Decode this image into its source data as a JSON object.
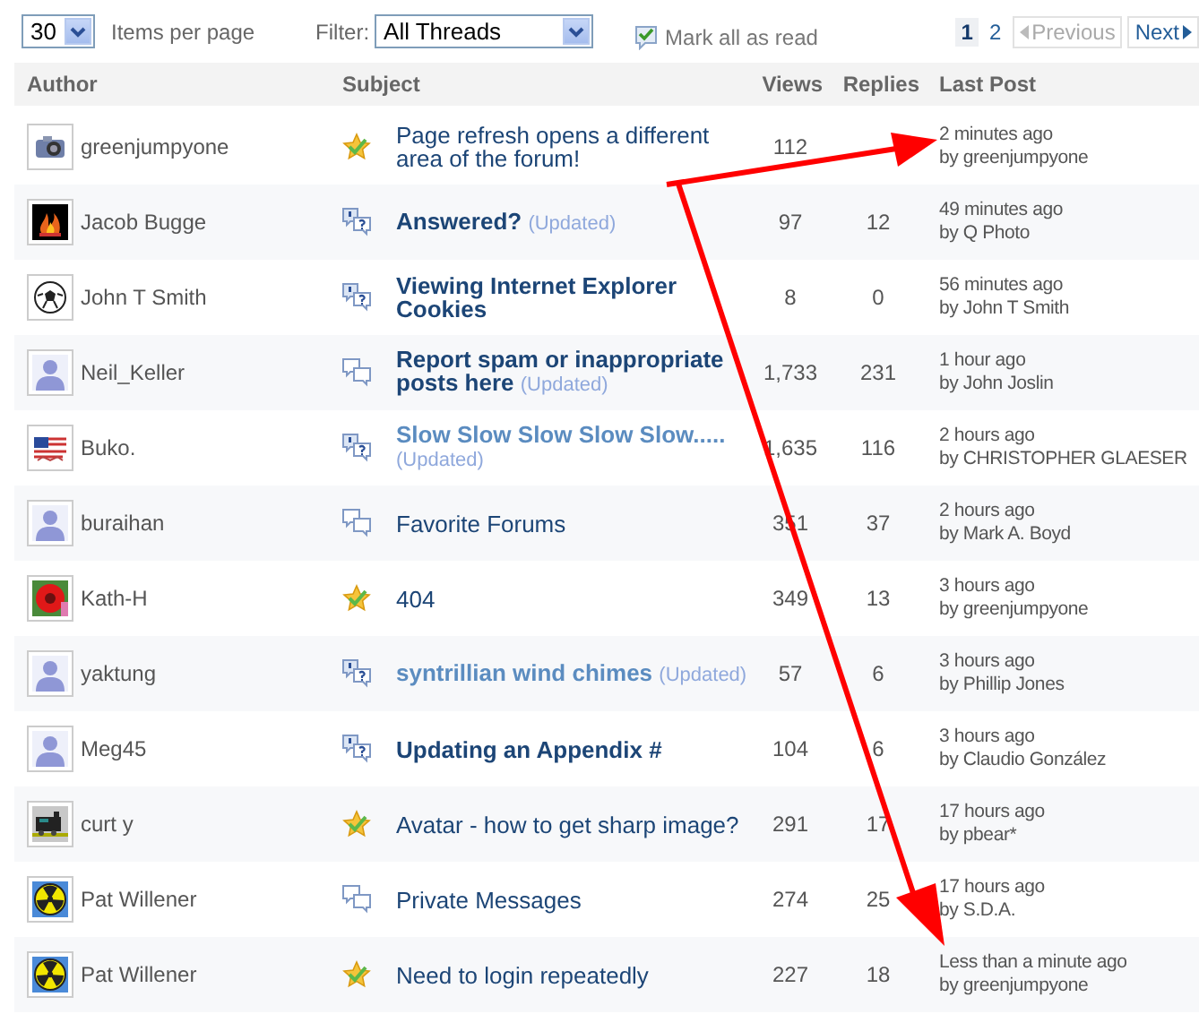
{
  "toolbar": {
    "page_size": "30",
    "page_size_label": "Items per page",
    "filter_label": "Filter:",
    "filter_value": "All Threads",
    "mark_read": "Mark all as read"
  },
  "pager": {
    "pages": [
      {
        "label": "1",
        "selected": true
      },
      {
        "label": "2",
        "selected": false
      }
    ],
    "previous": {
      "label": "Previous",
      "disabled": true
    },
    "next": {
      "label": "Next",
      "disabled": false
    }
  },
  "columns": [
    "Author",
    "Subject",
    "Views",
    "Replies",
    "Last Post"
  ],
  "threads": [
    {
      "author": "greenjumpyone",
      "kind": "answered",
      "subject": "Page refresh opens a different area of the forum!",
      "unread": false,
      "visited": false,
      "views": "112",
      "time": "2 minutes ago",
      "by": "by greenjumpyone"
    },
    {
      "author": "Jacob Bugge",
      "kind": "question",
      "subject": "Answered?",
      "updated": "(Updated)",
      "unread": true,
      "visited": false,
      "views": "97",
      "replies": "12",
      "time": "49 minutes ago",
      "by": "by Q Photo"
    },
    {
      "author": "John T Smith",
      "kind": "question",
      "subject": "Viewing Internet Explorer Cookies",
      "unread": true,
      "visited": false,
      "views": "8",
      "replies": "0",
      "time": "56 minutes ago",
      "by": "by John T Smith"
    },
    {
      "author": "Neil_Keller",
      "kind": "discussion",
      "subject": "Report spam or inappropriate posts here",
      "updated": "(Updated)",
      "unread": true,
      "visited": false,
      "views": "1,733",
      "replies": "231",
      "time": "1 hour ago",
      "by": "by John Joslin"
    },
    {
      "author": "Buko.",
      "kind": "question",
      "subject": "Slow Slow Slow Slow Slow.....",
      "updated": "(Updated)",
      "unread": true,
      "visited": true,
      "views": "1,635",
      "replies": "116",
      "time": "2 hours ago",
      "by": "by CHRISTOPHER GLAESER"
    },
    {
      "author": "buraihan",
      "kind": "discussion",
      "subject": "Favorite Forums",
      "unread": false,
      "visited": false,
      "views": "351",
      "replies": "37",
      "time": "2 hours ago",
      "by": "by Mark A. Boyd"
    },
    {
      "author": "Kath-H",
      "kind": "answered",
      "subject": "404",
      "unread": false,
      "visited": false,
      "views": "349",
      "replies": "13",
      "time": "3 hours ago",
      "by": "by greenjumpyone"
    },
    {
      "author": "yaktung",
      "kind": "question",
      "subject": "syntrillian wind chimes",
      "updated": "(Updated)",
      "unread": true,
      "visited": true,
      "views": "57",
      "replies": "6",
      "time": "3 hours ago",
      "by": "by Phillip Jones"
    },
    {
      "author": "Meg45",
      "kind": "question",
      "subject": "Updating an Appendix #",
      "unread": true,
      "visited": false,
      "views": "104",
      "replies": "6",
      "time": "3 hours ago",
      "by": "by Claudio González"
    },
    {
      "author": "curt y",
      "kind": "answered",
      "subject": "Avatar - how to get sharp image?",
      "unread": false,
      "visited": false,
      "views": "291",
      "replies": "17",
      "time": "17 hours ago",
      "by": "by pbear*"
    },
    {
      "author": "Pat Willener",
      "kind": "discussion",
      "subject": "Private Messages",
      "unread": false,
      "visited": false,
      "views": "274",
      "replies": "25",
      "time": "17 hours ago",
      "by": "by S.D.A."
    },
    {
      "author": "Pat Willener",
      "kind": "answered",
      "subject": "Need to login repeatedly",
      "unread": false,
      "visited": false,
      "views": "227",
      "replies": "18",
      "time": "Less than a minute ago",
      "by": "by greenjumpyone"
    }
  ]
}
